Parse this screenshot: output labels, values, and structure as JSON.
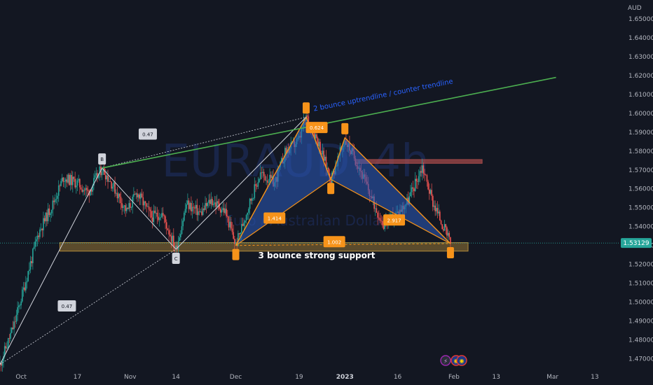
{
  "chart_data": {
    "type": "candlestick",
    "currency": "AUD",
    "watermark": {
      "symbol": "EURAUD",
      "timeframe": "4h",
      "name": "Euro / Australian Dollar"
    },
    "ylim": [
      1.465,
      1.66
    ],
    "y_ticks": [
      {
        "value": 1.47,
        "label": "1.47000"
      },
      {
        "value": 1.48,
        "label": "1.48000"
      },
      {
        "value": 1.49,
        "label": "1.49000"
      },
      {
        "value": 1.5,
        "label": "1.50000"
      },
      {
        "value": 1.51,
        "label": "1.51000"
      },
      {
        "value": 1.52,
        "label": "1.52000"
      },
      {
        "value": 1.53,
        "label": "1.53000"
      },
      {
        "value": 1.54,
        "label": "1.54000"
      },
      {
        "value": 1.55,
        "label": "1.55000"
      },
      {
        "value": 1.56,
        "label": "1.56000"
      },
      {
        "value": 1.57,
        "label": "1.57000"
      },
      {
        "value": 1.58,
        "label": "1.58000"
      },
      {
        "value": 1.59,
        "label": "1.59000"
      },
      {
        "value": 1.6,
        "label": "1.60000"
      },
      {
        "value": 1.61,
        "label": "1.61000"
      },
      {
        "value": 1.62,
        "label": "1.62000"
      },
      {
        "value": 1.63,
        "label": "1.63000"
      },
      {
        "value": 1.64,
        "label": "1.64000"
      },
      {
        "value": 1.65,
        "label": "1.65000"
      }
    ],
    "x_ticks": [
      {
        "date": "2022-10-01",
        "label": "Oct",
        "bold": false
      },
      {
        "date": "2022-10-17",
        "label": "17",
        "bold": false
      },
      {
        "date": "2022-11-01",
        "label": "Nov",
        "bold": false
      },
      {
        "date": "2022-11-14",
        "label": "14",
        "bold": false
      },
      {
        "date": "2022-12-01",
        "label": "Dec",
        "bold": false
      },
      {
        "date": "2022-12-19",
        "label": "19",
        "bold": false
      },
      {
        "date": "2023-01-01",
        "label": "2023",
        "bold": true
      },
      {
        "date": "2023-01-16",
        "label": "16",
        "bold": false
      },
      {
        "date": "2023-02-01",
        "label": "Feb",
        "bold": false
      },
      {
        "date": "2023-02-13",
        "label": "13",
        "bold": false
      },
      {
        "date": "2023-03-01",
        "label": "Mar",
        "bold": false
      },
      {
        "date": "2023-03-13",
        "label": "13",
        "bold": false
      }
    ],
    "xlim": [
      "2022-09-25",
      "2023-03-20"
    ],
    "last_price": {
      "value": 1.53129,
      "label": "1.53129"
    },
    "price_path": [
      [
        "2022-09-25",
        1.467
      ],
      [
        "2022-09-29",
        1.488
      ],
      [
        "2022-10-03",
        1.516
      ],
      [
        "2022-10-06",
        1.537
      ],
      [
        "2022-10-10",
        1.552
      ],
      [
        "2022-10-13",
        1.566
      ],
      [
        "2022-10-17",
        1.563
      ],
      [
        "2022-10-20",
        1.558
      ],
      [
        "2022-10-24",
        1.571
      ],
      [
        "2022-10-27",
        1.562
      ],
      [
        "2022-10-31",
        1.548
      ],
      [
        "2022-11-03",
        1.558
      ],
      [
        "2022-11-07",
        1.545
      ],
      [
        "2022-11-10",
        1.547
      ],
      [
        "2022-11-14",
        1.528
      ],
      [
        "2022-11-17",
        1.552
      ],
      [
        "2022-11-21",
        1.547
      ],
      [
        "2022-11-24",
        1.554
      ],
      [
        "2022-11-28",
        1.548
      ],
      [
        "2022-12-01",
        1.53
      ],
      [
        "2022-12-05",
        1.553
      ],
      [
        "2022-12-08",
        1.568
      ],
      [
        "2022-12-12",
        1.563
      ],
      [
        "2022-12-15",
        1.579
      ],
      [
        "2022-12-19",
        1.586
      ],
      [
        "2022-12-21",
        1.598
      ],
      [
        "2022-12-24",
        1.587
      ],
      [
        "2022-12-28",
        1.565
      ],
      [
        "2023-01-01",
        1.586
      ],
      [
        "2023-01-05",
        1.572
      ],
      [
        "2023-01-09",
        1.553
      ],
      [
        "2023-01-12",
        1.541
      ],
      [
        "2023-01-16",
        1.547
      ],
      [
        "2023-01-19",
        1.554
      ],
      [
        "2023-01-23",
        1.572
      ],
      [
        "2023-01-26",
        1.553
      ],
      [
        "2023-01-29",
        1.54
      ],
      [
        "2023-01-31",
        1.531
      ]
    ],
    "trendlines": [
      {
        "id": "uptrend",
        "color": "#4caf50",
        "points": [
          [
            "2022-10-24",
            1.571
          ],
          [
            "2023-03-02",
            1.619
          ]
        ],
        "label": "2 bounce uptrendline / counter trendline",
        "label_color": "#2962ff"
      },
      {
        "id": "support",
        "color": "#b38b3a",
        "fill": "#b38b3a",
        "type": "zone",
        "from": "2022-10-12",
        "to": "2023-02-05",
        "price_top": 1.5315,
        "price_bottom": 1.527,
        "label": "3 bounce strong support",
        "label_color": "#ffffff"
      },
      {
        "id": "resistance",
        "color": "#a34a4a",
        "type": "zone",
        "from": "2023-01-04",
        "to": "2023-02-09",
        "price_top": 1.5755,
        "price_bottom": 1.5735
      }
    ],
    "abcd_pattern": {
      "color": "#d1d4dc",
      "points": [
        {
          "date": "2022-09-25",
          "price": 1.467,
          "label": ""
        },
        {
          "date": "2022-10-24",
          "price": 1.571,
          "label": "B"
        },
        {
          "date": "2022-11-14",
          "price": 1.528,
          "label": "C"
        },
        {
          "date": "2022-12-21",
          "price": 1.598,
          "label": ""
        }
      ],
      "ratios": [
        {
          "date": "2022-10-14",
          "price": 1.498,
          "label": "0.47"
        },
        {
          "date": "2022-11-06",
          "price": 1.589,
          "label": "0.47"
        }
      ],
      "x_to_c_line": [
        [
          "2022-09-25",
          1.467
        ],
        [
          "2022-11-14",
          1.528
        ]
      ]
    },
    "harmonic_pattern": {
      "color": "#f7931a",
      "fill": "#2b5bbd",
      "points": [
        {
          "date": "2022-12-01",
          "price": 1.53,
          "label": ""
        },
        {
          "date": "2022-12-21",
          "price": 1.598,
          "label": ""
        },
        {
          "date": "2022-12-28",
          "price": 1.565,
          "label": ""
        },
        {
          "date": "2023-01-01",
          "price": 1.587,
          "label": ""
        },
        {
          "date": "2023-01-31",
          "price": 1.531,
          "label": ""
        }
      ],
      "ratios": [
        {
          "date": "2022-12-12",
          "price": 1.5445,
          "label": "1.414"
        },
        {
          "date": "2022-12-24",
          "price": 1.5925,
          "label": "0.624"
        },
        {
          "date": "2023-01-15",
          "price": 1.5435,
          "label": "2.917"
        },
        {
          "date": "2022-12-29",
          "price": 1.532,
          "label": "1.002"
        }
      ]
    }
  },
  "ui": {
    "badge_lightning": "⚡",
    "badge_flags": "◉"
  }
}
